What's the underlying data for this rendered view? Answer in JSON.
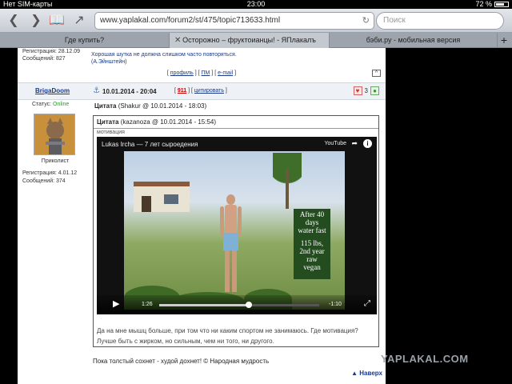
{
  "status_bar": {
    "carrier": "Нет SIM-карты",
    "time": "23:00",
    "battery_level": "72 %",
    "battery_fraction": 0.72
  },
  "toolbar": {
    "url": "www.yaplakal.com/forum2/st/475/topic713633.html",
    "search_placeholder": "Поиск"
  },
  "tabs": [
    {
      "label": "Где купить?",
      "active": false
    },
    {
      "label": "Осторожно – фруктоианцы! - ЯПлакалъ",
      "active": true
    },
    {
      "label": "бэби.ру - мобильная версия",
      "active": false
    }
  ],
  "prev_post": {
    "reg_line": "Регистрация: 28.12.09",
    "messages_line": "Сообщений: 827",
    "signature_line1": "Хорошая шутка не должна слишком часто повторяться.",
    "signature_line2": "(А.Эйнштейн)",
    "action_profile": "профиль",
    "action_pm": "ПМ",
    "action_email": "e-mail",
    "up_button": "^"
  },
  "post": {
    "author": "BrigaDoom",
    "date": "10.01.2014 - 20:04",
    "number": "911",
    "quote_action": "цитировать",
    "rating": "3",
    "status_label": "Статус:",
    "status_value": "Online",
    "rank": "Приколист",
    "reg_line": "Регистрация: 4.01.12",
    "messages_line": "Сообщений: 374",
    "outer_quote_label": "Цитата",
    "outer_quote_meta": "(Shakur @ 10.01.2014 - 18:03)",
    "inner_quote_label": "Цитата",
    "inner_quote_meta": "(kazanoza @ 10.01.2014 - 15:54)",
    "topic": "мотивация",
    "quote_text": "Да на мне мышц больше, при том что ни каким спортом не занимаюсь. Где мотивация? Лучше быть с жирком, но сильным, чем ни того, ни другого.",
    "signature": "Пока толстый сохнет - худой дохнет! © Народная мудрость",
    "up_link": "Наверх"
  },
  "video": {
    "title": "Lukas Ircha — 7 лет сыроедения",
    "brand": "YouTube",
    "sign_lines": [
      "After 40",
      "days",
      "water fast",
      "",
      "115 lbs,",
      "2nd year",
      "raw",
      "vegan"
    ],
    "current_time": "1:26",
    "remaining_time": "-1:10",
    "progress_fraction": 0.56
  },
  "watermark": "YAPLAKAL.COM",
  "icons": [
    "back-icon",
    "forward-icon",
    "bookmarks-icon",
    "share-icon",
    "reload-icon",
    "close-tab-icon",
    "new-tab-icon",
    "anchor-icon",
    "rating-minus-icon",
    "rating-plus-icon",
    "play-icon",
    "fullscreen-icon",
    "info-icon"
  ]
}
